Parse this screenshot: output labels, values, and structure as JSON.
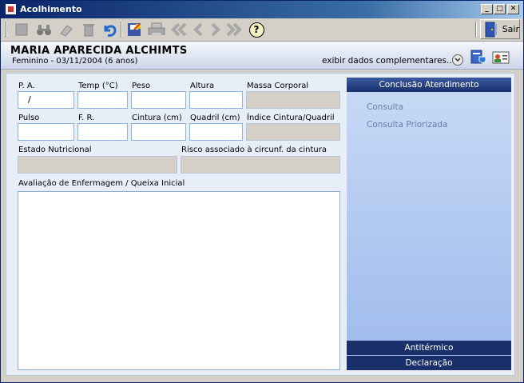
{
  "window": {
    "title": "Acolhimento",
    "minimize": "_",
    "maximize": "□",
    "close": "✕"
  },
  "toolbar": {
    "exit_label": "Sair",
    "help_label": "?"
  },
  "patient": {
    "name": "MARIA APARECIDA ALCHIMTS",
    "info": "Feminino - 03/11/2004 (6 anos)",
    "more_data_link": "exibir dados complementares..."
  },
  "form": {
    "pa_label": "P. A.",
    "pa_value": "/",
    "temp_label": "Temp (°C)",
    "peso_label": "Peso",
    "altura_label": "Altura",
    "massa_label": "Massa Corporal",
    "pulso_label": "Pulso",
    "fr_label": "F. R.",
    "cintura_label": "Cintura (cm)",
    "quadril_label": "Quadril (cm)",
    "indice_label": "Índice Cintura/Quadril",
    "estado_label": "Estado Nutricional",
    "risco_label": "Risco associado à circunf. da cintura",
    "avaliacao_label": "Avaliação de Enfermagem / Queixa Inicial"
  },
  "right_panel": {
    "header": "Conclusão Atendimento",
    "items": [
      "Consulta",
      "Consulta Priorizada"
    ],
    "antitermico": "Antitérmico",
    "declaracao": "Declaração"
  },
  "colors": {
    "title_bar": "#0a246a",
    "panel_header": "#19306b",
    "input_border": "#8fb2d8"
  }
}
